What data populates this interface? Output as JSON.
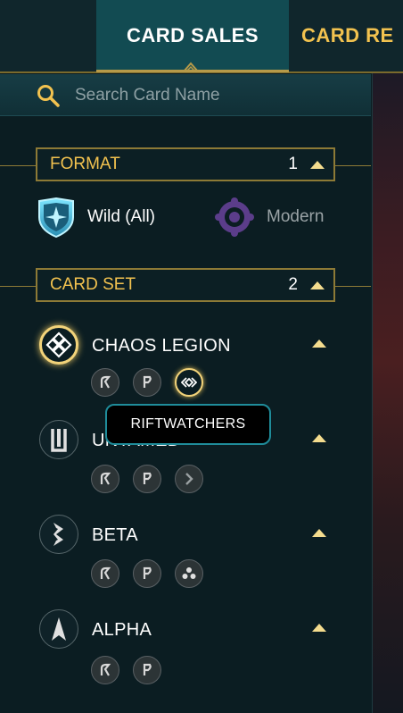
{
  "nav": {
    "tabs": [
      {
        "label": "CARD SALES",
        "active": true
      },
      {
        "label": "CARD RE",
        "active": false
      }
    ]
  },
  "search": {
    "placeholder": "Search Card Name",
    "value": ""
  },
  "format": {
    "title": "FORMAT",
    "count": "1",
    "options": [
      {
        "label": "Wild (All)",
        "icon": "wild-shield-icon",
        "selected": true
      },
      {
        "label": "Modern",
        "icon": "modern-gear-icon",
        "selected": false
      }
    ]
  },
  "card_set": {
    "title": "CARD SET",
    "count": "2",
    "sets": [
      {
        "name": "CHAOS LEGION",
        "icon": "chaos-legion-icon",
        "selected": true,
        "editions": [
          "reward-edition-icon",
          "promo-edition-icon",
          "riftwatchers-edition-icon"
        ]
      },
      {
        "name": "UNTAMED",
        "icon": "untamed-icon",
        "selected": false,
        "editions": [
          "reward-edition-icon",
          "promo-edition-icon",
          "untamed-edition-icon"
        ]
      },
      {
        "name": "BETA",
        "icon": "beta-icon",
        "selected": false,
        "editions": [
          "reward-edition-icon",
          "promo-edition-icon",
          "beta-edition-icon"
        ]
      },
      {
        "name": "ALPHA",
        "icon": "alpha-icon",
        "selected": false,
        "editions": [
          "reward-edition-icon",
          "promo-edition-icon"
        ]
      }
    ]
  },
  "tooltip": {
    "text": "RIFTWATCHERS"
  },
  "colors": {
    "accent_gold": "#f2c24f",
    "tab_active_bg": "#124b52",
    "tooltip_border": "#1f8c9a"
  }
}
